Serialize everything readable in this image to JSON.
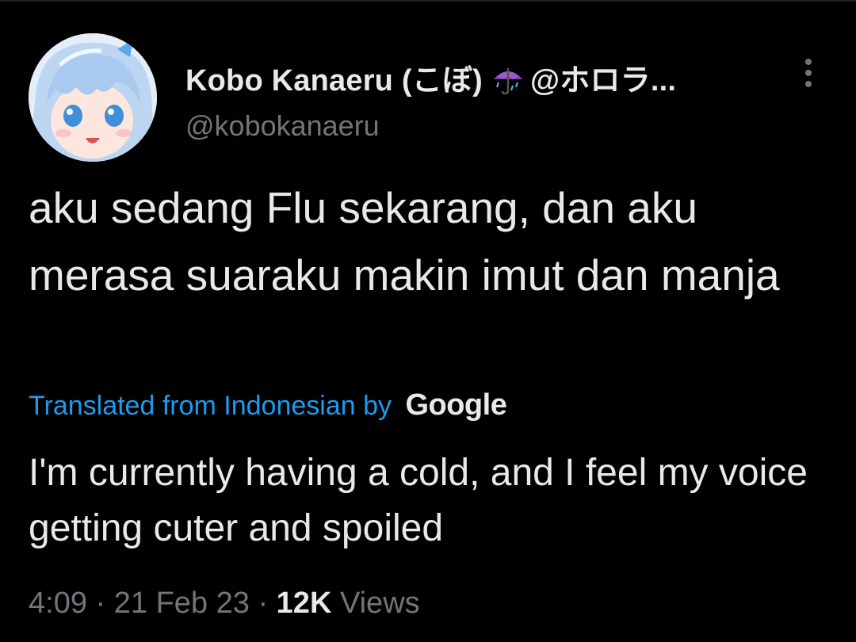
{
  "tweet": {
    "author": {
      "display_name": "Kobo Kanaeru (こぼ)",
      "display_name_suffix": "@ホロラ...",
      "handle": "@kobokanaeru",
      "badge_icon": "umbrella-rain-icon"
    },
    "text": "aku sedang Flu sekarang, dan aku merasa suaraku makin imut dan manja",
    "translation": {
      "label": "Translated from Indonesian by",
      "provider": "Google",
      "text": "I'm currently having a cold, and I feel my voice getting cuter and spoiled"
    },
    "meta": {
      "time": "4:09",
      "separator": " · ",
      "date": "21 Feb 23",
      "views_count": "12K",
      "views_label": "Views"
    }
  },
  "colors": {
    "background": "#000000",
    "text_primary": "#e7e9ea",
    "text_secondary": "#71767b",
    "accent": "#1d9bf0"
  }
}
